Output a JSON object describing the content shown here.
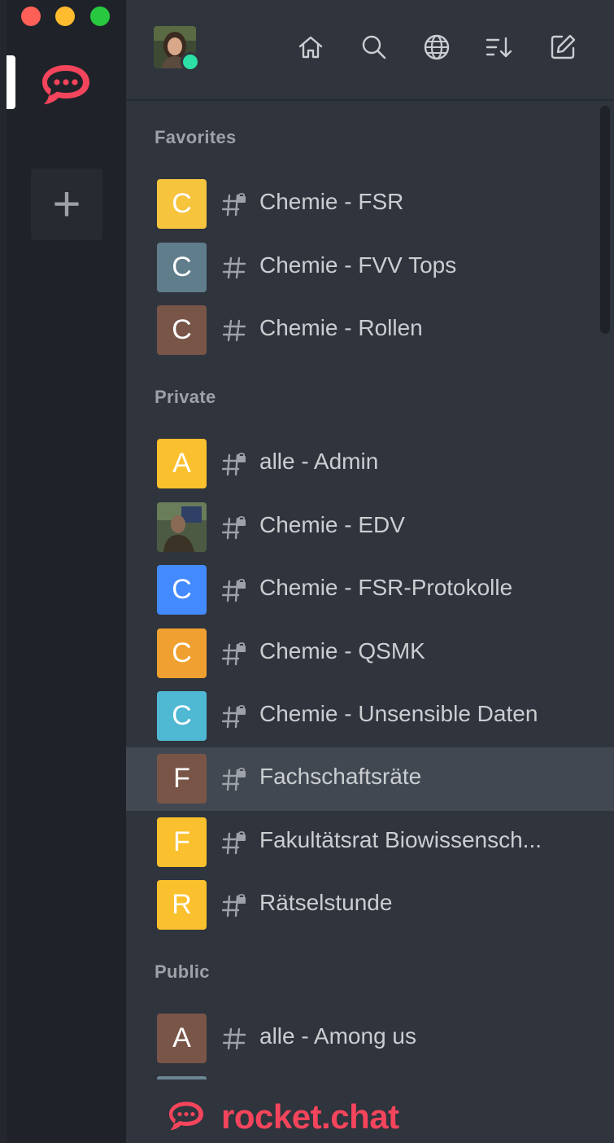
{
  "window": {
    "controls": [
      "close",
      "minimize",
      "zoom"
    ]
  },
  "servers": {
    "active_icon": "rocketchat-logo-icon",
    "add_label": "+"
  },
  "header": {
    "icons": [
      "home-icon",
      "search-icon",
      "globe-icon",
      "sort-icon",
      "edit-icon"
    ],
    "user_status_color": "#2de0a5"
  },
  "sections": [
    {
      "title": "Favorites",
      "rooms": [
        {
          "letter": "C",
          "color": "#f6c43d",
          "name": "Chemie - FSR",
          "type": "private"
        },
        {
          "letter": "C",
          "color": "#607d8b",
          "name": "Chemie - FVV Tops",
          "type": "public"
        },
        {
          "letter": "C",
          "color": "#795548",
          "name": "Chemie - Rollen",
          "type": "public"
        }
      ]
    },
    {
      "title": "Private",
      "rooms": [
        {
          "letter": "A",
          "color": "#fbc02d",
          "name": "alle - Admin",
          "type": "private"
        },
        {
          "letter": "",
          "color": "#3c4a3a",
          "name": "Chemie - EDV",
          "type": "private",
          "photo": true
        },
        {
          "letter": "C",
          "color": "#448aff",
          "name": "Chemie - FSR-Protokolle",
          "type": "private"
        },
        {
          "letter": "C",
          "color": "#f0a030",
          "name": "Chemie - QSMK",
          "type": "private"
        },
        {
          "letter": "C",
          "color": "#4fb8d3",
          "name": "Chemie - Unsensible Daten",
          "type": "private"
        },
        {
          "letter": "F",
          "color": "#795548",
          "name": "Fachschaftsräte",
          "type": "private",
          "active": true
        },
        {
          "letter": "F",
          "color": "#fbc02d",
          "name": "Fakultätsrat Biowissensch...",
          "type": "private"
        },
        {
          "letter": "R",
          "color": "#fbc02d",
          "name": "Rätselstunde",
          "type": "private"
        }
      ]
    },
    {
      "title": "Public",
      "rooms": [
        {
          "letter": "A",
          "color": "#795548",
          "name": "alle - Among us",
          "type": "public"
        }
      ]
    }
  ],
  "footer": {
    "brand": "rocket.chat",
    "brand_color": "#f5455c"
  }
}
